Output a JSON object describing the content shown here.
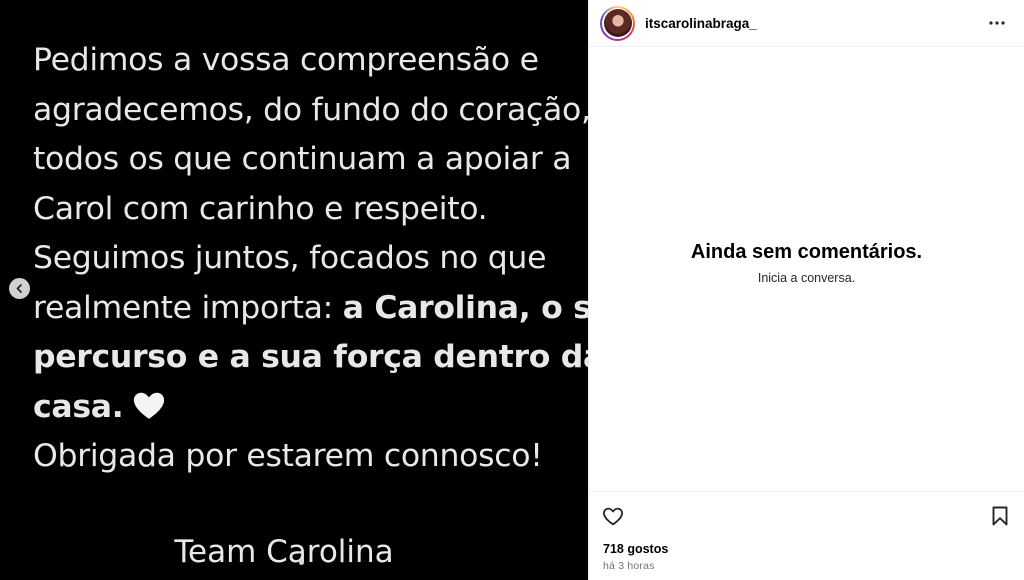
{
  "post": {
    "lines": [
      {
        "text": " Pedimos a vossa compreensão e"
      },
      {
        "text": "agradecemos, do fundo do coração,"
      },
      {
        "text": "todos os que continuam a apoiar a"
      },
      {
        "text": "Carol com carinho e respeito."
      },
      {
        "text": "Seguimos juntos, focados no que"
      },
      {
        "text": "realmente importa: ",
        "bold": "a Carolina, o seu"
      },
      {
        "bold": "percurso e a sua força dentro da"
      },
      {
        "bold": "casa."
      },
      {
        "text": "Obrigada por estarem connosco!"
      }
    ],
    "signature": "Team Carolina",
    "heart_emoji": "white-heart-icon",
    "background_color": "#000000",
    "text_color": "#e8e8e8"
  },
  "header": {
    "username": "itscarolinabraga_"
  },
  "comments": {
    "empty_title": "Ainda sem comentários.",
    "empty_subtitle": "Inicia a conversa."
  },
  "footer": {
    "likes": "718 gostos",
    "time": "há 3 horas"
  },
  "icons": {
    "prev": "chevron-left-icon",
    "more": "more-horizontal-icon",
    "like": "heart-outline-icon",
    "save": "bookmark-icon"
  }
}
